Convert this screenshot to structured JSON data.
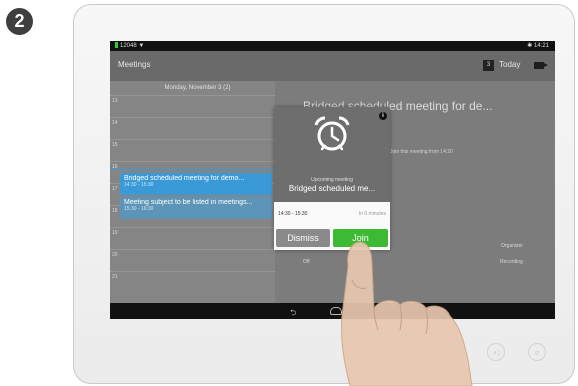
{
  "step": "2",
  "status_bar": {
    "left": "12048 ▼",
    "right": "✱ 14:21"
  },
  "appbar": {
    "title": "Meetings",
    "calendar_icon_text": "3",
    "today": "Today",
    "camera_icon": "video-camera-icon"
  },
  "calendar": {
    "day_header": "Monday, November 3 (2)",
    "hours": [
      "13",
      "14",
      "15",
      "16",
      "17",
      "18",
      "19",
      "20",
      "21"
    ],
    "events": [
      {
        "title": "Bridged scheduled meeting for demo...",
        "time": "14:30 - 15:30"
      },
      {
        "title": "Meeting subject to be listed in meetings...",
        "time": "15:30 - 16:30"
      }
    ]
  },
  "details": {
    "title": "Bridged scheduled meeting for de...",
    "subtitle": "Join this meeting from 14:20",
    "organizer_label": "Organizer",
    "recording_value": "Off",
    "recording_label": "Recording"
  },
  "popup": {
    "upcoming_label": "Upcoming meeting",
    "title": "Bridged scheduled me...",
    "time": "14:30 - 15:30",
    "eta": "In 9 minutes",
    "dismiss": "Dismiss",
    "join": "Join",
    "info_icon": "i"
  },
  "colors": {
    "accent_blue": "#3a9ad8",
    "join_green": "#3cba34"
  }
}
